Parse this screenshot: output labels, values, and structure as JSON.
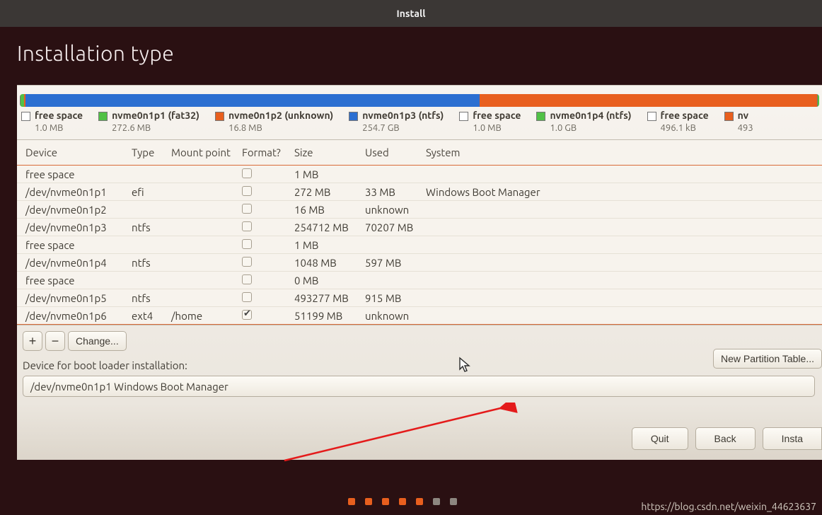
{
  "window_title": "Install",
  "page_title": "Installation type",
  "disk_segments": [
    {
      "color": "#7a756b",
      "flex": 1
    },
    {
      "color": "#51c146",
      "flex": 5
    },
    {
      "color": "#e85f1e",
      "flex": 2
    },
    {
      "color": "#2c6fd1",
      "flex": 620
    },
    {
      "color": "#e85f1e",
      "flex": 460
    },
    {
      "color": "#7a756b",
      "flex": 1
    },
    {
      "color": "#51c146",
      "flex": 2
    }
  ],
  "legend": [
    {
      "color": "#ffffff",
      "name": "free space",
      "sub": "1.0 MB"
    },
    {
      "color": "#51c146",
      "name": "nvme0n1p1 (fat32)",
      "sub": "272.6 MB"
    },
    {
      "color": "#e85f1e",
      "name": "nvme0n1p2 (unknown)",
      "sub": "16.8 MB"
    },
    {
      "color": "#2c6fd1",
      "name": "nvme0n1p3 (ntfs)",
      "sub": "254.7 GB"
    },
    {
      "color": "#ffffff",
      "name": "free space",
      "sub": "1.0 MB"
    },
    {
      "color": "#51c146",
      "name": "nvme0n1p4 (ntfs)",
      "sub": "1.0 GB"
    },
    {
      "color": "#ffffff",
      "name": "free space",
      "sub": "496.1 kB"
    },
    {
      "color": "#e85f1e",
      "name": "nv",
      "sub": "493"
    }
  ],
  "columns": {
    "device": "Device",
    "type": "Type",
    "mount": "Mount point",
    "format": "Format?",
    "size": "Size",
    "used": "Used",
    "system": "System"
  },
  "rows": [
    {
      "device": "free space",
      "type": "",
      "mount": "",
      "format": false,
      "size": "1 MB",
      "used": "",
      "system": ""
    },
    {
      "device": "/dev/nvme0n1p1",
      "type": "efi",
      "mount": "",
      "format": false,
      "size": "272 MB",
      "used": "33 MB",
      "system": "Windows Boot Manager"
    },
    {
      "device": "/dev/nvme0n1p2",
      "type": "",
      "mount": "",
      "format": false,
      "size": "16 MB",
      "used": "unknown",
      "system": ""
    },
    {
      "device": "/dev/nvme0n1p3",
      "type": "ntfs",
      "mount": "",
      "format": false,
      "size": "254712 MB",
      "used": "70207 MB",
      "system": ""
    },
    {
      "device": "free space",
      "type": "",
      "mount": "",
      "format": false,
      "size": "1 MB",
      "used": "",
      "system": ""
    },
    {
      "device": "/dev/nvme0n1p4",
      "type": "ntfs",
      "mount": "",
      "format": false,
      "size": "1048 MB",
      "used": "597 MB",
      "system": ""
    },
    {
      "device": "free space",
      "type": "",
      "mount": "",
      "format": false,
      "size": "0 MB",
      "used": "",
      "system": ""
    },
    {
      "device": "/dev/nvme0n1p5",
      "type": "ntfs",
      "mount": "",
      "format": false,
      "size": "493277 MB",
      "used": "915 MB",
      "system": ""
    },
    {
      "device": "/dev/nvme0n1p6",
      "type": "ext4",
      "mount": "/home",
      "format": true,
      "size": "51199 MB",
      "used": "unknown",
      "system": ""
    }
  ],
  "toolbar": {
    "add": "+",
    "remove": "−",
    "change": "Change...",
    "new_pt": "New Partition Table..."
  },
  "bootloader": {
    "label": "Device for boot loader installation:",
    "value": "/dev/nvme0n1p1   Windows Boot Manager"
  },
  "footer": {
    "quit": "Quit",
    "back": "Back",
    "install": "Insta"
  },
  "watermark": "https://blog.csdn.net/weixin_44623637"
}
